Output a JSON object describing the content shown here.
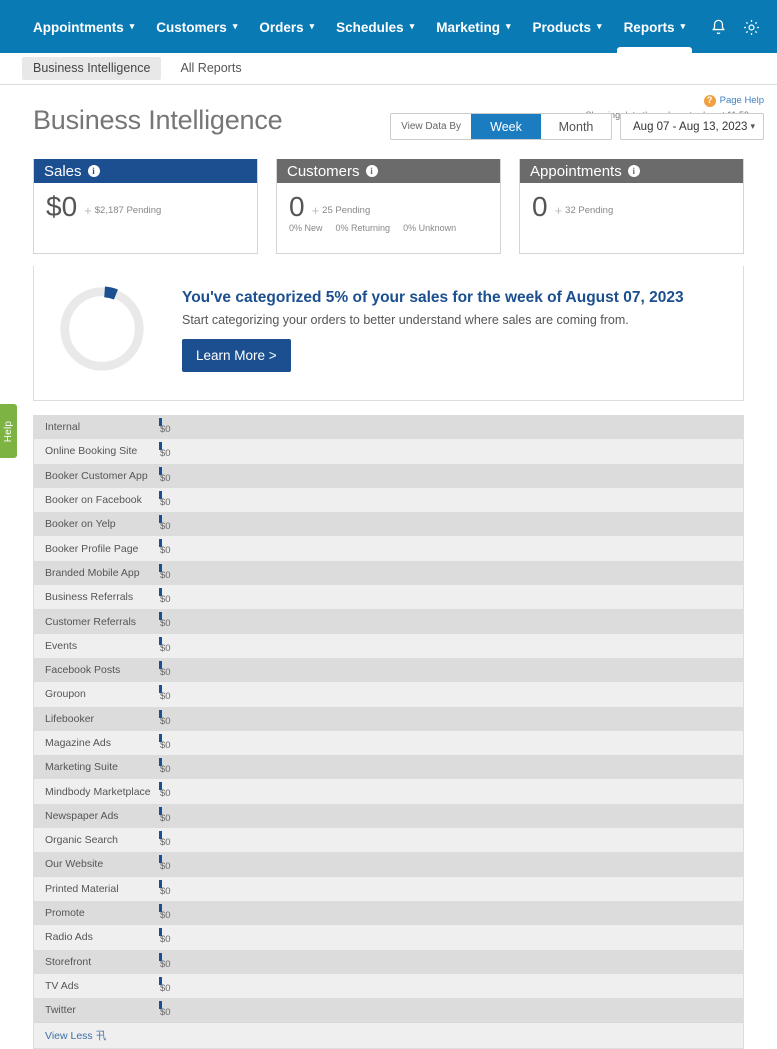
{
  "topnav": {
    "items": [
      {
        "label": "Appointments",
        "caret": "▾",
        "active": false
      },
      {
        "label": "Customers",
        "caret": "▾",
        "active": false
      },
      {
        "label": "Orders",
        "caret": "▾",
        "active": false
      },
      {
        "label": "Schedules",
        "caret": "▾",
        "active": false
      },
      {
        "label": "Marketing",
        "caret": "▾",
        "active": false
      },
      {
        "label": "Products",
        "caret": "▾",
        "active": false
      },
      {
        "label": "Reports",
        "caret": "▾",
        "active": true
      }
    ],
    "icons": [
      "bell-icon",
      "gear-icon"
    ],
    "bg_color": "#0a7ab5"
  },
  "subnav": {
    "items": [
      {
        "label": "Business Intelligence",
        "active": true
      },
      {
        "label": "All Reports",
        "active": false
      }
    ]
  },
  "header": {
    "title": "Business Intelligence",
    "page_help": "Page Help",
    "help_glyph": "?",
    "showing_data": "Showing data through yesterday at 11:59pm."
  },
  "controls": {
    "view_data_by_label": "View Data By",
    "segments": [
      {
        "label": "Week",
        "active": true
      },
      {
        "label": "Month",
        "active": false
      }
    ],
    "date_range": "Aug 07 - Aug 13, 2023",
    "date_chevron": "⌄",
    "accent_color": "#1c7cc0"
  },
  "cards": [
    {
      "title": "Sales",
      "head_style": "blue",
      "info_glyph": "i",
      "value": "$0",
      "pending": "$2,187 Pending",
      "plus": "+",
      "breakdown": []
    },
    {
      "title": "Customers",
      "head_style": "gray",
      "info_glyph": "i",
      "value": "0",
      "pending": "25 Pending",
      "plus": "+",
      "breakdown": [
        "0% New",
        "0% Returning",
        "0% Unknown"
      ]
    },
    {
      "title": "Appointments",
      "head_style": "gray",
      "info_glyph": "i",
      "value": "0",
      "pending": "32 Pending",
      "plus": "+",
      "breakdown": []
    }
  ],
  "categorize": {
    "title": "You've categorized 5% of your sales for the week of August 07, 2023",
    "subtitle": "Start categorizing your orders to better understand where sales are coming from.",
    "button_label": "Learn More >",
    "percent": 5,
    "donut_fill_color": "#1b4f8f",
    "donut_track_color": "#e9e9e9"
  },
  "source_list": {
    "rows": [
      {
        "label": "Internal",
        "amount": "$0"
      },
      {
        "label": "Online Booking Site",
        "amount": "$0"
      },
      {
        "label": "Booker Customer App",
        "amount": "$0"
      },
      {
        "label": "Booker on Facebook",
        "amount": "$0"
      },
      {
        "label": "Booker on Yelp",
        "amount": "$0"
      },
      {
        "label": "Booker Profile Page",
        "amount": "$0"
      },
      {
        "label": "Branded Mobile App",
        "amount": "$0"
      },
      {
        "label": "Business Referrals",
        "amount": "$0"
      },
      {
        "label": "Customer Referrals",
        "amount": "$0"
      },
      {
        "label": "Events",
        "amount": "$0"
      },
      {
        "label": "Facebook Posts",
        "amount": "$0"
      },
      {
        "label": "Groupon",
        "amount": "$0"
      },
      {
        "label": "Lifebooker",
        "amount": "$0"
      },
      {
        "label": "Magazine Ads",
        "amount": "$0"
      },
      {
        "label": "Marketing Suite",
        "amount": "$0"
      },
      {
        "label": "Mindbody Marketplace",
        "amount": "$0"
      },
      {
        "label": "Newspaper Ads",
        "amount": "$0"
      },
      {
        "label": "Organic Search",
        "amount": "$0"
      },
      {
        "label": "Our Website",
        "amount": "$0"
      },
      {
        "label": "Printed Material",
        "amount": "$0"
      },
      {
        "label": "Promote",
        "amount": "$0"
      },
      {
        "label": "Radio Ads",
        "amount": "$0"
      },
      {
        "label": "Storefront",
        "amount": "$0"
      },
      {
        "label": "TV Ads",
        "amount": "$0"
      },
      {
        "label": "Twitter",
        "amount": "$0"
      }
    ],
    "view_less": "View Less 卂"
  },
  "help_tab": {
    "label": "Help",
    "color": "#7cb342"
  }
}
